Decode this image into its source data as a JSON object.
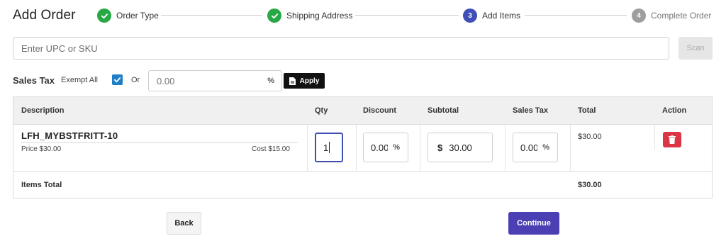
{
  "header": {
    "title": "Add Order",
    "steps": [
      {
        "number": "",
        "label": "Order Type",
        "state": "done"
      },
      {
        "number": "",
        "label": "Shipping Address",
        "state": "done"
      },
      {
        "number": "3",
        "label": "Add Items",
        "state": "active"
      },
      {
        "number": "4",
        "label": "Complete Order",
        "state": "todo"
      }
    ]
  },
  "search": {
    "placeholder": "Enter UPC or SKU",
    "value": "",
    "scan_label": "Scan"
  },
  "sales_tax": {
    "label": "Sales Tax",
    "exempt_label": "Exempt All",
    "exempt_checked": true,
    "or_label": "Or",
    "rate_value": "0.00",
    "percent_symbol": "%",
    "apply_label": "Apply"
  },
  "table": {
    "columns": [
      "Description",
      "Qty",
      "Discount",
      "Subtotal",
      "Sales Tax",
      "Total",
      "Action"
    ],
    "rows": [
      {
        "sku": "LFH_MYBSTFRITT-10",
        "price": "Price $30.00",
        "cost": "Cost $15.00",
        "qty": "1",
        "discount": "0.00",
        "discount_symbol": "%",
        "subtotal_currency": "$",
        "subtotal": "30.00",
        "sales_tax": "0.00",
        "sales_tax_symbol": "%",
        "total": "$30.00"
      }
    ],
    "items_total_label": "Items Total",
    "items_total_value": "$30.00"
  },
  "footer": {
    "back_label": "Back",
    "continue_label": "Continue"
  },
  "colors": {
    "step_done": "#28a745",
    "step_active": "#3f4fb5",
    "step_todo": "#9e9e9e",
    "checkbox": "#1e7ec8",
    "delete": "#dc3545",
    "continue": "#4a3fb3"
  },
  "icons": {
    "step_done": "check-icon",
    "apply": "document-icon",
    "delete": "trash-icon",
    "percent": "percent-icon"
  }
}
